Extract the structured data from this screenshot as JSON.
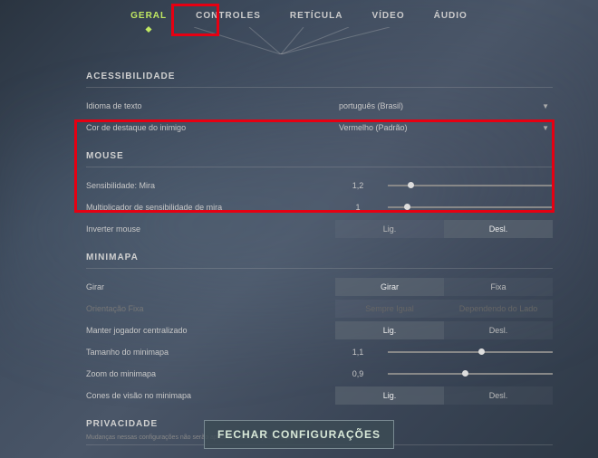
{
  "tabs": {
    "items": [
      {
        "label": "GERAL",
        "active": true
      },
      {
        "label": "CONTROLES",
        "active": false
      },
      {
        "label": "RETÍCULA",
        "active": false
      },
      {
        "label": "VÍDEO",
        "active": false
      },
      {
        "label": "ÁUDIO",
        "active": false
      }
    ]
  },
  "sections": {
    "accessibility": {
      "title": "ACESSIBILIDADE",
      "lang_label": "Idioma de texto",
      "lang_value": "português (Brasil)",
      "enemy_label": "Cor de destaque do inimigo",
      "enemy_value": "Vermelho (Padrão)"
    },
    "mouse": {
      "title": "MOUSE",
      "sens_label": "Sensibilidade: Mira",
      "sens_value": "1,2",
      "sens_pct": 12,
      "mult_label": "Multiplicador de sensibilidade de mira",
      "mult_value": "1",
      "mult_pct": 10,
      "invert_label": "Inverter mouse",
      "on": "Lig.",
      "off": "Desl."
    },
    "minimap": {
      "title": "MINIMAPA",
      "rotate_label": "Girar",
      "rotate_a": "Girar",
      "rotate_b": "Fixa",
      "orient_label": "Orientação Fixa",
      "orient_a": "Sempre Igual",
      "orient_b": "Dependendo do Lado",
      "center_label": "Manter jogador centralizado",
      "on": "Lig.",
      "off": "Desl.",
      "size_label": "Tamanho do minimapa",
      "size_value": "1,1",
      "size_pct": 55,
      "zoom_label": "Zoom do minimapa",
      "zoom_value": "0,9",
      "zoom_pct": 45,
      "cones_label": "Cones de visão no minimapa"
    },
    "privacy": {
      "title": "PRIVACIDADE",
      "note": "Mudanças nessas configurações não serão aplicadas até sua próxima partida"
    }
  },
  "footer": {
    "close": "FECHAR CONFIGURAÇÕES"
  }
}
